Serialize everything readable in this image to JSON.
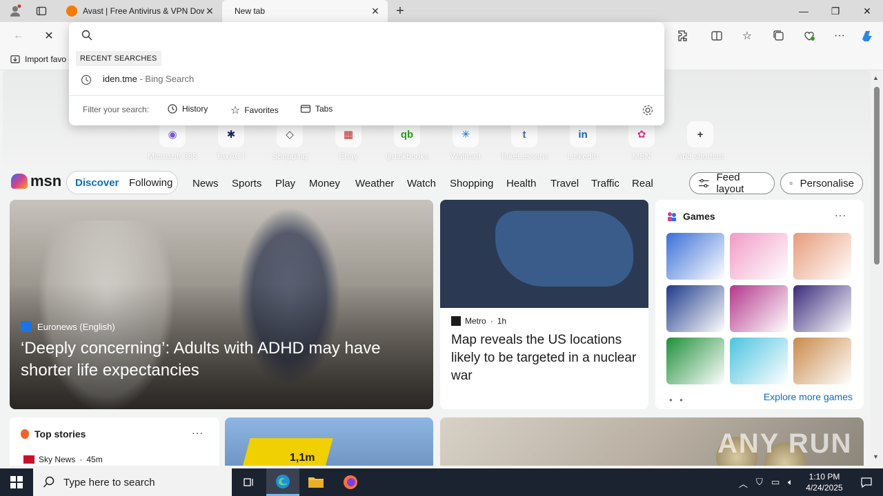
{
  "browser": {
    "tabs": [
      {
        "label": "Avast | Free Antivirus & VPN Dow",
        "active": false
      },
      {
        "label": "New tab",
        "active": true
      }
    ],
    "favorites_bar": {
      "import_label": "Import favo"
    }
  },
  "address_dropdown": {
    "query": "",
    "recent_label": "RECENT SEARCHES",
    "recent": [
      {
        "term": "iden.tme",
        "suffix": " - Bing Search"
      }
    ],
    "filter_label": "Filter your search:",
    "filters": [
      "History",
      "Favorites",
      "Tabs"
    ]
  },
  "shortcuts": [
    {
      "label": "Microsoft 365",
      "glyph": "◉",
      "color": "#7b5cd6"
    },
    {
      "label": "TaxACT",
      "glyph": "✱",
      "color": "#1a2b5c"
    },
    {
      "label": "Shopping",
      "glyph": "◇",
      "color": "#444444"
    },
    {
      "label": "Ebay",
      "glyph": "▦",
      "color": "#c62828"
    },
    {
      "label": "Quickbooks",
      "glyph": "qb",
      "color": "#2ca01c"
    },
    {
      "label": "Walmart",
      "glyph": "✳",
      "color": "#0071ce"
    },
    {
      "label": "TakeLessons",
      "glyph": "t",
      "color": "#3b6fb6"
    },
    {
      "label": "LinkedIn",
      "glyph": "in",
      "color": "#0a66c2"
    },
    {
      "label": "MSN",
      "glyph": "✿",
      "color": "#d63f8c"
    },
    {
      "label": "Add shortcut",
      "glyph": "+",
      "color": "#333333"
    }
  ],
  "msn": {
    "logo": "msn",
    "discover": "Discover",
    "following": "Following",
    "nav": [
      "News",
      "Sports",
      "Play",
      "Money",
      "Weather",
      "Watch",
      "Shopping",
      "Health",
      "Travel",
      "Traffic",
      "Real E"
    ],
    "feed_layout": "Feed layout",
    "personalise": "Personalise"
  },
  "hero": {
    "source": "Euronews (English)",
    "title": "‘Deeply concerning’: Adults with ADHD may have shorter life expectancies"
  },
  "map_story": {
    "source": "Metro",
    "age": "1h",
    "title": "Map reveals the US locations likely to be targeted in a nuclear war"
  },
  "games": {
    "title": "Games",
    "explore": "Explore more games",
    "tiles": [
      "#3a6fd8",
      "#f29bc6",
      "#e89a7a",
      "#1e3a8a",
      "#b3378c",
      "#3b2a7a",
      "#1f8f3a",
      "#4cc4e0",
      "#c98a4a"
    ]
  },
  "top_stories": {
    "title": "Top stories",
    "source": "Sky News",
    "age": "45m"
  },
  "solar": {
    "label": "1,1m"
  },
  "watermark": "ANY RUN",
  "taskbar": {
    "search_placeholder": "Type here to search",
    "time": "1:10 PM",
    "date": "4/24/2025"
  }
}
